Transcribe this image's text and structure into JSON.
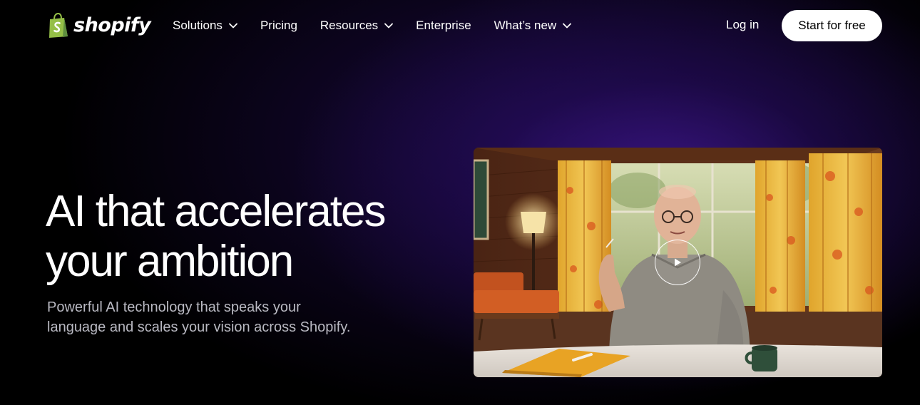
{
  "nav": {
    "logo_text": "shopify",
    "links": [
      {
        "label": "Solutions",
        "has_dropdown": true
      },
      {
        "label": "Pricing",
        "has_dropdown": false
      },
      {
        "label": "Resources",
        "has_dropdown": true
      },
      {
        "label": "Enterprise",
        "has_dropdown": false
      },
      {
        "label": "What’s new",
        "has_dropdown": true
      }
    ],
    "login_label": "Log in",
    "cta_label": "Start for free"
  },
  "hero": {
    "title_line1": "AI that accelerates",
    "title_line2": "your ambition",
    "subtitle_line1": "Powerful AI technology that speaks your",
    "subtitle_line2": "language and scales your vision across Shopify."
  },
  "video": {
    "play_icon": "play-icon"
  },
  "colors": {
    "brand_green": "#95bf47",
    "background": "#000000",
    "glow_purple": "#3e168c",
    "cta_bg": "#ffffff",
    "subtitle_text": "#b9b9c2"
  }
}
